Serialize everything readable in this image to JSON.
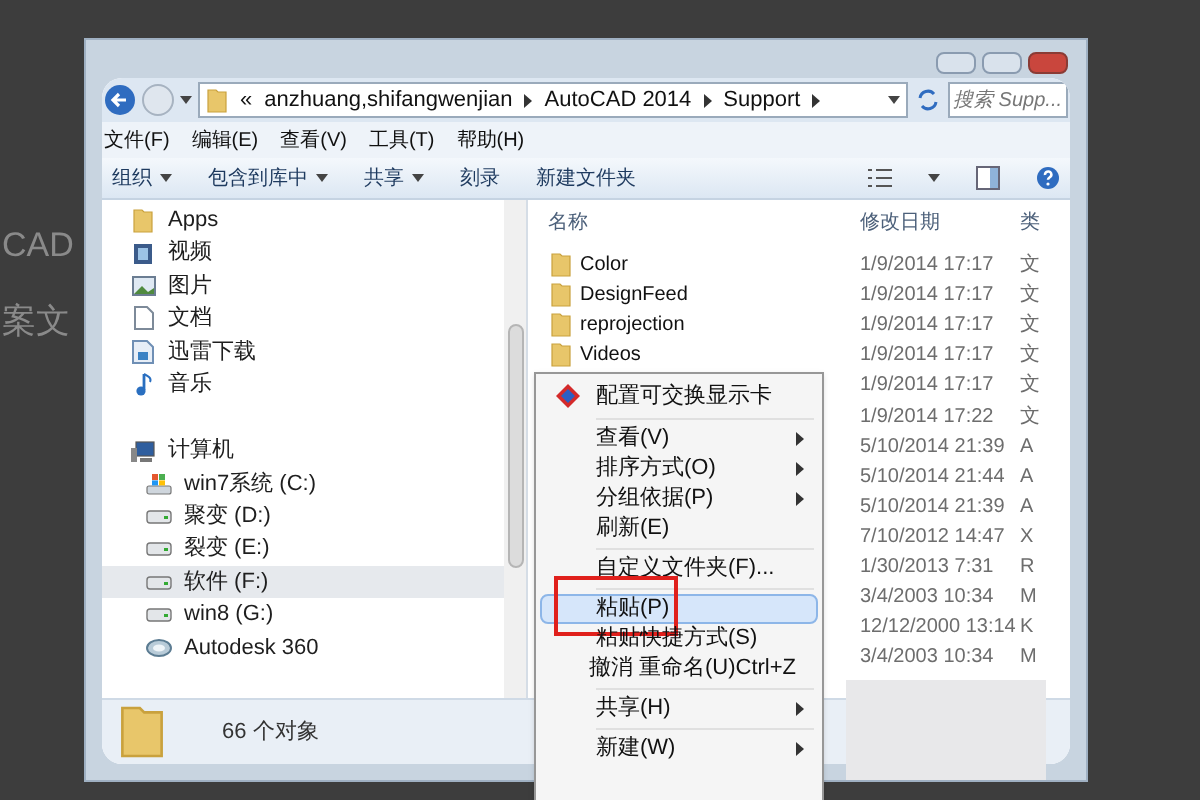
{
  "background_text": [
    "CAD",
    "案文"
  ],
  "address_bar": {
    "prefix": "«",
    "crumbs": [
      "anzhuang,shifangwenjian",
      "AutoCAD 2014",
      "Support"
    ]
  },
  "search": {
    "placeholder": "搜索 Supp..."
  },
  "menu_bar": [
    "文件(F)",
    "编辑(E)",
    "查看(V)",
    "工具(T)",
    "帮助(H)"
  ],
  "toolbar": [
    {
      "label": "组织",
      "dropdown": true
    },
    {
      "label": "包含到库中",
      "dropdown": true
    },
    {
      "label": "共享",
      "dropdown": true
    },
    {
      "label": "刻录",
      "dropdown": false
    },
    {
      "label": "新建文件夹",
      "dropdown": false
    }
  ],
  "nav_pane": [
    {
      "label": "Apps",
      "kind": "folder",
      "selected": false
    },
    {
      "label": "视频",
      "kind": "video",
      "selected": false
    },
    {
      "label": "图片",
      "kind": "picture",
      "selected": false
    },
    {
      "label": "文档",
      "kind": "document",
      "selected": false
    },
    {
      "label": "迅雷下载",
      "kind": "download",
      "selected": false
    },
    {
      "label": "音乐",
      "kind": "music",
      "selected": false
    },
    {
      "label": "计算机",
      "kind": "computer",
      "selected": false,
      "children": [
        {
          "label": "win7系统 (C:)",
          "kind": "system",
          "selected": false
        },
        {
          "label": "聚变 (D:)",
          "kind": "drive",
          "selected": false
        },
        {
          "label": "裂变 (E:)",
          "kind": "drive",
          "selected": false
        },
        {
          "label": "软件 (F:)",
          "kind": "drive",
          "selected": true
        },
        {
          "label": "win8 (G:)",
          "kind": "drive",
          "selected": false
        },
        {
          "label": "Autodesk 360",
          "kind": "cloud",
          "selected": false
        }
      ]
    }
  ],
  "columns": [
    "名称",
    "修改日期",
    "类"
  ],
  "files": [
    {
      "name": "Color",
      "date": "1/9/2014 17:17",
      "type": "文"
    },
    {
      "name": "DesignFeed",
      "date": "1/9/2014 17:17",
      "type": "文"
    },
    {
      "name": "reprojection",
      "date": "1/9/2014 17:17",
      "type": "文"
    },
    {
      "name": "Videos",
      "date": "1/9/2014 17:17",
      "type": "文"
    },
    {
      "date": "1/9/2014 17:17",
      "type": "文"
    },
    {
      "date": "1/9/2014 17:22",
      "type": "文"
    },
    {
      "date": "5/10/2014 21:39",
      "type": "A"
    },
    {
      "date": "5/10/2014 21:44",
      "type": "A"
    },
    {
      "date": "5/10/2014 21:39",
      "type": "A"
    },
    {
      "date": "7/10/2012 14:47",
      "type": "X"
    },
    {
      "date": "1/30/2013 7:31",
      "type": "R"
    },
    {
      "date": "3/4/2003 10:34",
      "type": "M"
    },
    {
      "date": "12/12/2000 13:14",
      "type": "K"
    },
    {
      "date": "3/4/2003 10:34",
      "type": "M"
    }
  ],
  "status_bar": {
    "count": "66 个对象"
  },
  "context_menu": [
    {
      "kind": "app",
      "label": "配置可交换显示卡"
    },
    {
      "kind": "separator"
    },
    {
      "kind": "item",
      "label": "查看(V)",
      "submenu": true,
      "selected": false,
      "annotated": false
    },
    {
      "kind": "item",
      "label": "排序方式(O)",
      "submenu": true,
      "selected": false,
      "annotated": false
    },
    {
      "kind": "item",
      "label": "分组依据(P)",
      "submenu": true,
      "selected": false,
      "annotated": false
    },
    {
      "kind": "item",
      "label": "刷新(E)",
      "submenu": false,
      "selected": false,
      "annotated": false
    },
    {
      "kind": "separator"
    },
    {
      "kind": "item",
      "label": "自定义文件夹(F)...",
      "submenu": false,
      "selected": false,
      "annotated": false
    },
    {
      "kind": "separator"
    },
    {
      "kind": "item",
      "label": "粘贴(P)",
      "submenu": false,
      "selected": true,
      "annotated": true
    },
    {
      "kind": "item",
      "label": "粘贴快捷方式(S)",
      "submenu": false,
      "selected": false,
      "annotated": false
    },
    {
      "kind": "item",
      "label": "撤消 重命名(U)",
      "shortcut": "Ctrl+Z",
      "submenu": false,
      "selected": false,
      "annotated": false
    },
    {
      "kind": "separator"
    },
    {
      "kind": "item",
      "label": "共享(H)",
      "submenu": true,
      "selected": false,
      "annotated": false
    },
    {
      "kind": "separator"
    },
    {
      "kind": "item",
      "label": "新建(W)",
      "submenu": true,
      "selected": false,
      "annotated": false
    }
  ]
}
